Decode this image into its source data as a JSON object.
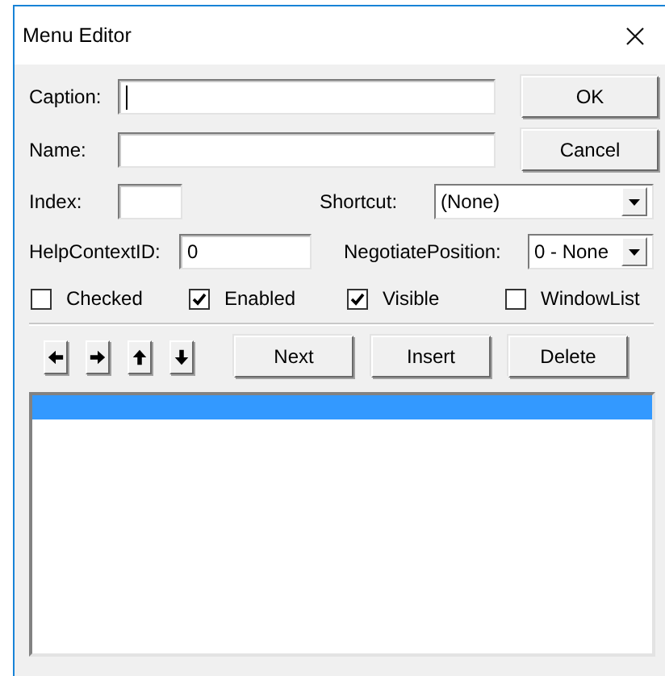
{
  "window": {
    "title": "Menu Editor"
  },
  "caption": {
    "label": "Caption:",
    "focused": true
  },
  "name": {
    "label": "Name:",
    "focused": false
  },
  "dialog_buttons": [
    {
      "label": "OK"
    },
    {
      "label": "Cancel"
    }
  ],
  "index": {
    "label": "Index:",
    "focused": false
  },
  "shortcut": {
    "label": "Shortcut:",
    "value": "(None)"
  },
  "help_context_id": {
    "label": "HelpContextID:",
    "value": "0",
    "focused": false
  },
  "negotiate_position": {
    "label": "NegotiatePosition:",
    "value": "0 - None"
  },
  "options": [
    {
      "label": "Checked",
      "checked": false
    },
    {
      "label": "Enabled",
      "checked": true
    },
    {
      "label": "Visible",
      "checked": true
    },
    {
      "label": "WindowList",
      "checked": false
    }
  ],
  "arrow_buttons": [
    {
      "kind": "left"
    },
    {
      "kind": "right"
    },
    {
      "kind": "up"
    },
    {
      "kind": "down"
    }
  ],
  "edit_buttons": [
    {
      "label": "Next"
    },
    {
      "label": "Insert"
    },
    {
      "label": "Delete"
    }
  ],
  "menu_list": {
    "items": [
      {
        "selected": true
      }
    ]
  }
}
